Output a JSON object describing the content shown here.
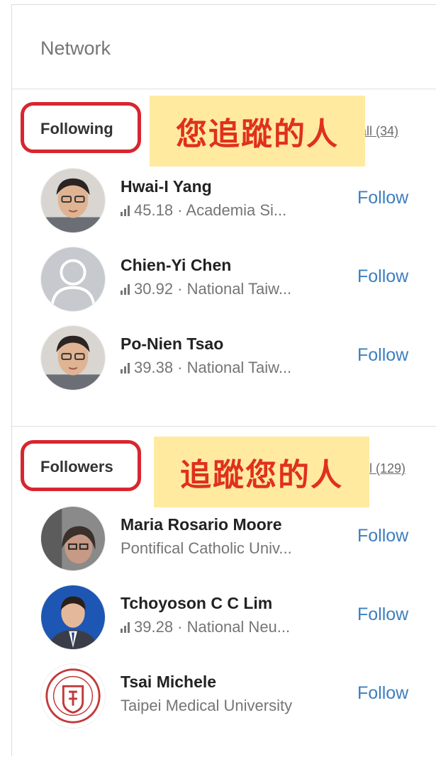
{
  "panel": {
    "title": "Network"
  },
  "following": {
    "label": "Following",
    "annotation": "您追蹤的人",
    "see_all": "all (34)",
    "people": [
      {
        "name": "Hwai-I Yang",
        "meta": "45.18 · Academia Si...",
        "has_score_icon": true,
        "follow_label": "Follow",
        "avatar": "photo-man-glasses"
      },
      {
        "name": "Chien-Yi Chen",
        "meta": "30.92 · National Taiw...",
        "has_score_icon": true,
        "follow_label": "Follow",
        "avatar": "default-avatar"
      },
      {
        "name": "Po-Nien Tsao",
        "meta": "39.38 · National Taiw...",
        "has_score_icon": true,
        "follow_label": "Follow",
        "avatar": "photo-man-glasses"
      }
    ]
  },
  "followers": {
    "label": "Followers",
    "annotation": "追蹤您的人",
    "see_all": "l (129)",
    "people": [
      {
        "name": "Maria Rosario Moore",
        "meta": "Pontifical Catholic Univ...",
        "has_score_icon": false,
        "follow_label": "Follow",
        "avatar": "photo-woman"
      },
      {
        "name": "Tchoyoson C C Lim",
        "meta": "39.28 · National Neu...",
        "has_score_icon": true,
        "follow_label": "Follow",
        "avatar": "photo-man-suit"
      },
      {
        "name": "Tsai Michele",
        "meta": "Taipei Medical University",
        "has_score_icon": false,
        "follow_label": "Follow",
        "avatar": "university-seal"
      }
    ]
  },
  "colors": {
    "annotation_red": "#e0301e",
    "annotation_bg": "#ffeaa0",
    "ring_red": "#d7262f",
    "follow_blue": "#3d7fbf"
  }
}
